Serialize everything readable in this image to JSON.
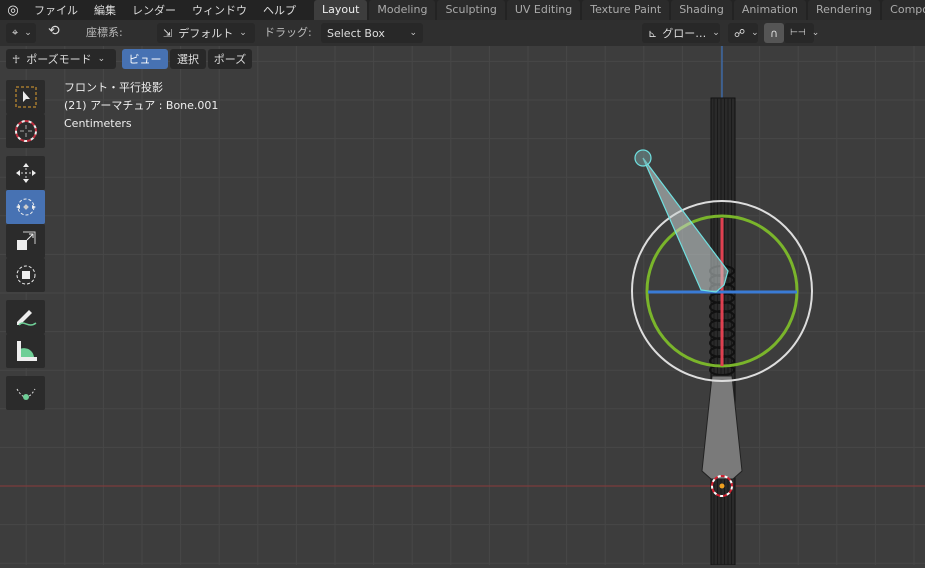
{
  "menubar": {
    "logo": "blender-logo",
    "items": [
      "ファイル",
      "編集",
      "レンダー",
      "ウィンドウ",
      "ヘルプ"
    ]
  },
  "workspaces": {
    "active": "Layout",
    "tabs": [
      "Layout",
      "Modeling",
      "Sculpting",
      "UV Editing",
      "Texture Paint",
      "Shading",
      "Animation",
      "Rendering",
      "Compositing"
    ]
  },
  "header": {
    "coord_label": "座標系:",
    "coord_value": "デフォルト",
    "drag_label": "ドラッグ:",
    "drag_value": "Select Box",
    "pivot_value": "グロー…"
  },
  "mode_row": {
    "mode": "ポーズモード",
    "view": "ビュー",
    "select": "選択",
    "pose": "ポーズ"
  },
  "overlay": {
    "view_name": "フロント・平行投影",
    "object": "(21) アーマチュア : Bone.001",
    "units": "Centimeters"
  },
  "toolbar": {
    "tools": [
      "select-box",
      "cursor",
      "move",
      "rotate",
      "scale",
      "transform",
      "annotate",
      "measure",
      "bone-envelope"
    ],
    "active": "rotate"
  },
  "colors": {
    "accent": "#4772b3",
    "x_axis": "#c0404a",
    "z_axis": "#3a7bd5",
    "gizmo_green": "#7ab52b",
    "bone_select": "#6fe0e0"
  }
}
